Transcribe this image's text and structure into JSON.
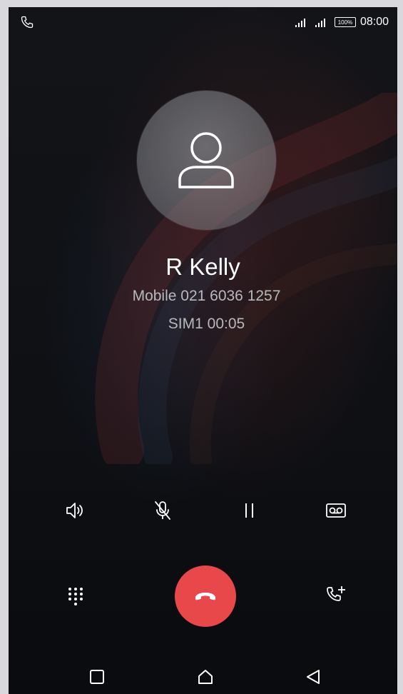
{
  "status_bar": {
    "left_icon": "phone-call-icon",
    "signal_icons": [
      "signal-icon",
      "signal-icon"
    ],
    "battery_label": "100%",
    "time": "08:00"
  },
  "caller": {
    "avatar_icon": "person-icon",
    "name": "R Kelly",
    "number_line": "Mobile 021 6036 1257",
    "info_line": "SIM1 00:05"
  },
  "controls": {
    "row1": [
      "speaker-icon",
      "mute-mic-icon",
      "pause-icon",
      "voicemail-record-icon"
    ],
    "row2": {
      "left": "dialpad-icon",
      "center": "end-call-icon",
      "right": "add-call-icon"
    }
  },
  "nav_bar": [
    "recents-icon",
    "home-icon",
    "back-icon"
  ],
  "colors": {
    "end_call": "#e84849",
    "text_primary": "#ffffff",
    "text_secondary": "#b8b9bd",
    "background": "#0e1014"
  }
}
